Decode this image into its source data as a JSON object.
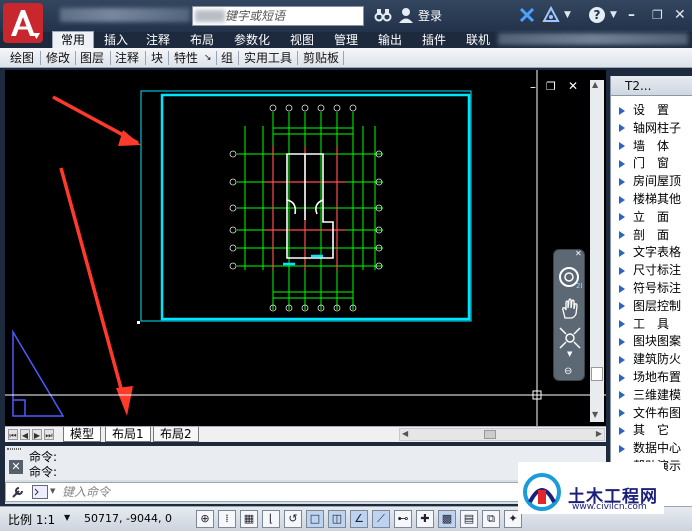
{
  "titlebar": {
    "search_placeholder": "键字或短语",
    "login_label": "登录"
  },
  "ribbon": {
    "tabs": [
      "常用",
      "插入",
      "注释",
      "布局",
      "参数化",
      "视图",
      "管理",
      "输出",
      "插件",
      "联机"
    ],
    "active_tab": "常用"
  },
  "panels": [
    "绘图",
    "修改",
    "图层",
    "注释",
    "块",
    "特性",
    "组",
    "实用工具",
    "剪贴板"
  ],
  "drawing": {
    "background": "#000000",
    "frame_color": "#00e5ff",
    "grid_color": "#00ff00",
    "wall_color": "#ff4d4d"
  },
  "layout_tabs": [
    "模型",
    "布局1",
    "布局2"
  ],
  "command": {
    "history": [
      "命令:",
      "命令:"
    ],
    "input_placeholder": "键入命令"
  },
  "statusbar": {
    "scale": "比例 1:1",
    "coords": "50717, -9044, 0"
  },
  "palette": {
    "title": "T2...",
    "items": [
      "设　置",
      "轴网柱子",
      "墙　体",
      "门　窗",
      "房间屋顶",
      "楼梯其他",
      "立　面",
      "剖　面",
      "文字表格",
      "尺寸标注",
      "符号标注",
      "图层控制",
      "工　具",
      "图块图案",
      "建筑防火",
      "场地布置",
      "三维建模",
      "文件布图",
      "其　它",
      "数据中心",
      "帮助演示"
    ]
  },
  "watermark": {
    "name": "土木工程网",
    "url": "www.civilcn.com"
  }
}
